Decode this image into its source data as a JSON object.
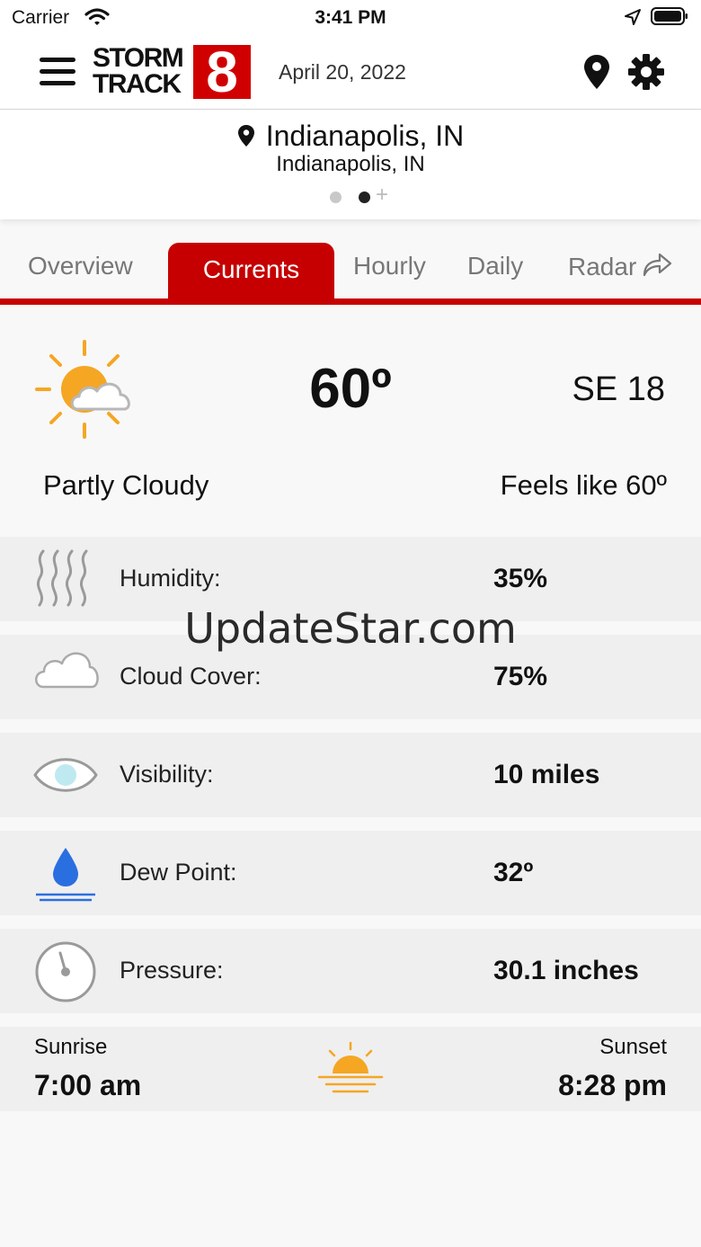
{
  "status_bar": {
    "carrier": "Carrier",
    "time": "3:41 PM"
  },
  "header": {
    "logo_line1": "STORM",
    "logo_line2": "TRACK",
    "logo_number": "8",
    "date": "April 20, 2022"
  },
  "location": {
    "city": "Indianapolis, IN",
    "subtitle": "Indianapolis, IN",
    "pages": 2,
    "active_page": 2
  },
  "tabs": [
    {
      "label": "Overview"
    },
    {
      "label": "Currents",
      "active": true
    },
    {
      "label": "Hourly"
    },
    {
      "label": "Daily"
    },
    {
      "label": "Radar"
    }
  ],
  "current": {
    "temperature": "60º",
    "wind": "SE 18",
    "condition": "Partly Cloudy",
    "feels_like": "Feels like 60º",
    "icon": "partly-cloudy-icon"
  },
  "details": [
    {
      "label": "Humidity:",
      "value": "35%",
      "icon": "humidity-icon"
    },
    {
      "label": "Cloud Cover:",
      "value": "75%",
      "icon": "cloud-icon"
    },
    {
      "label": "Visibility:",
      "value": "10 miles",
      "icon": "eye-icon"
    },
    {
      "label": "Dew Point:",
      "value": "32º",
      "icon": "water-drop-icon"
    },
    {
      "label": "Pressure:",
      "value": "30.1 inches",
      "icon": "pressure-gauge-icon"
    }
  ],
  "sun": {
    "sunrise_label": "Sunrise",
    "sunrise": "7:00 am",
    "sunset_label": "Sunset",
    "sunset": "8:28 pm"
  },
  "watermark": "UpdateStar.com",
  "colors": {
    "brand_red": "#c60000",
    "sun_orange": "#f5a623",
    "drop_blue": "#2a6fe0"
  }
}
